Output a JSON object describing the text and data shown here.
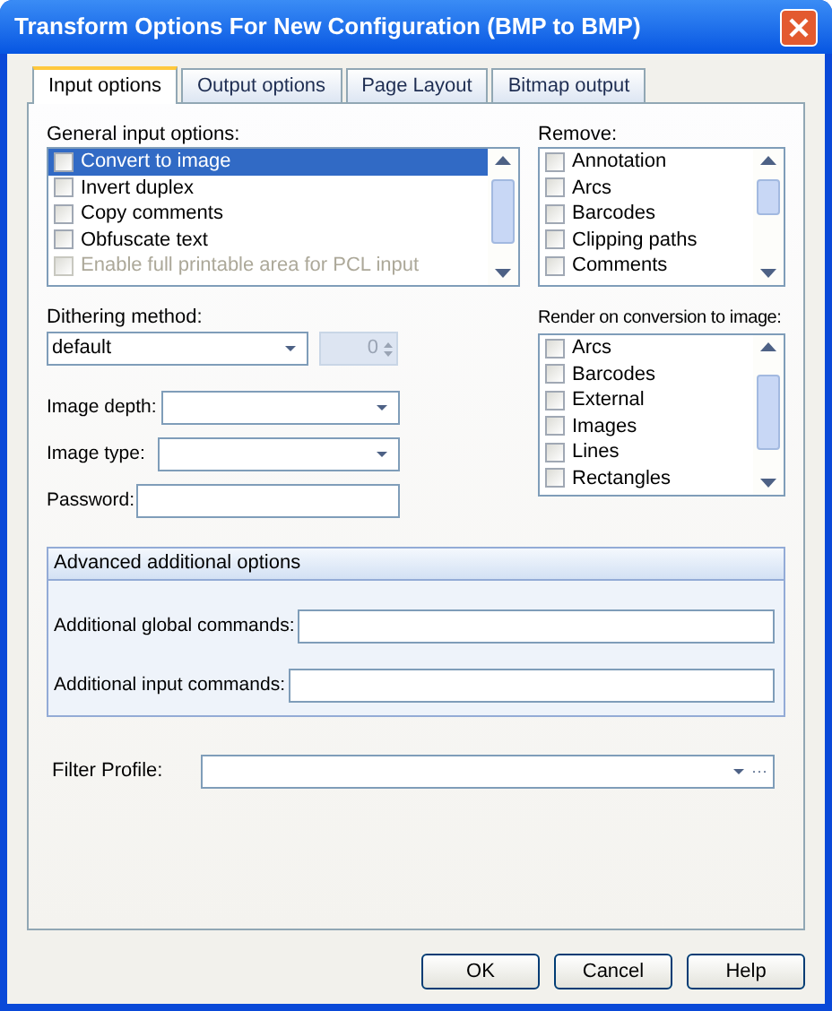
{
  "window": {
    "title": "Transform Options For New Configuration (BMP to BMP)"
  },
  "tabs": [
    {
      "label": "Input options",
      "selected": true
    },
    {
      "label": "Output options",
      "selected": false
    },
    {
      "label": "Page Layout",
      "selected": false
    },
    {
      "label": "Bitmap output",
      "selected": false
    }
  ],
  "general_input_options": {
    "label": "General input options:",
    "items": [
      {
        "label": "Convert to image",
        "checked": false,
        "selected": true,
        "disabled": false
      },
      {
        "label": "Invert duplex",
        "checked": false,
        "selected": false,
        "disabled": false
      },
      {
        "label": "Copy comments",
        "checked": false,
        "selected": false,
        "disabled": false
      },
      {
        "label": "Obfuscate text",
        "checked": false,
        "selected": false,
        "disabled": false
      },
      {
        "label": "Enable full printable area for PCL input",
        "checked": false,
        "selected": false,
        "disabled": true
      }
    ]
  },
  "remove": {
    "label": "Remove:",
    "items": [
      {
        "label": "Annotation",
        "checked": false
      },
      {
        "label": "Arcs",
        "checked": false
      },
      {
        "label": "Barcodes",
        "checked": false
      },
      {
        "label": "Clipping paths",
        "checked": false
      },
      {
        "label": "Comments",
        "checked": false
      }
    ]
  },
  "dithering_method": {
    "label": "Dithering method:",
    "value": "default",
    "spin_value": "0"
  },
  "image_depth": {
    "label": "Image depth:"
  },
  "image_type": {
    "label": "Image type:"
  },
  "password": {
    "label": "Password:"
  },
  "render_on_conversion": {
    "label": "Render on conversion to image:",
    "items": [
      {
        "label": "Arcs",
        "checked": false
      },
      {
        "label": "Barcodes",
        "checked": false
      },
      {
        "label": "External",
        "checked": false
      },
      {
        "label": "Images",
        "checked": false
      },
      {
        "label": "Lines",
        "checked": false
      },
      {
        "label": "Rectangles",
        "checked": false
      }
    ]
  },
  "advanced": {
    "title": "Advanced additional options",
    "fields": [
      {
        "label": "Additional global commands:"
      },
      {
        "label": "Additional input commands:"
      }
    ]
  },
  "filter_profile": {
    "label": "Filter Profile:",
    "browse": "···"
  },
  "buttons": [
    {
      "label": "OK"
    },
    {
      "label": "Cancel"
    },
    {
      "label": "Help"
    }
  ]
}
